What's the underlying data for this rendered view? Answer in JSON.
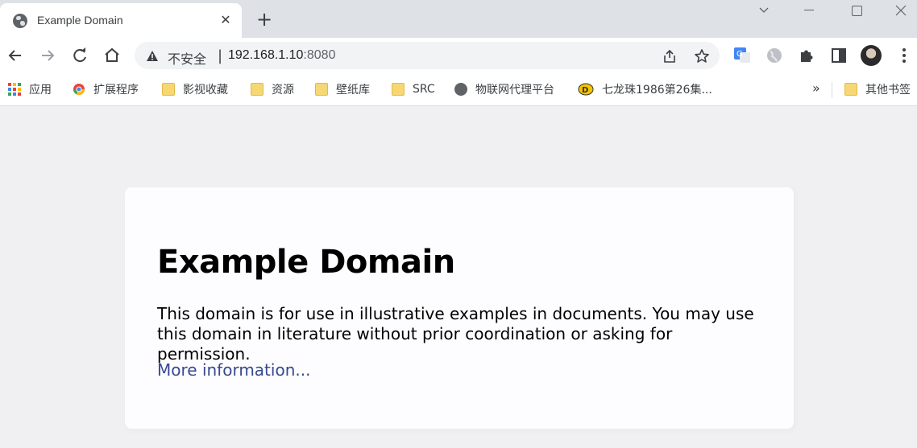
{
  "tab": {
    "title": "Example Domain",
    "close": "✕"
  },
  "new_tab": "+",
  "omnibox": {
    "security_label": "不安全",
    "separator": "|",
    "host": "192.168.1.10",
    "port": ":8080"
  },
  "bookmarks": {
    "items": [
      {
        "label": "应用",
        "icon": "apps-grid-icon"
      },
      {
        "label": "扩展程序",
        "icon": "chrome-icon"
      },
      {
        "label": "影视收藏",
        "icon": "folder-icon"
      },
      {
        "label": "资源",
        "icon": "folder-icon"
      },
      {
        "label": "壁纸库",
        "icon": "folder-icon"
      },
      {
        "label": "SRC",
        "icon": "folder-icon"
      },
      {
        "label": "物联网代理平台",
        "icon": "globe-icon"
      },
      {
        "label": "七龙珠1986第26集...",
        "icon": "dragon-ball-icon"
      }
    ],
    "more": "»",
    "other": {
      "label": "其他书签",
      "icon": "folder-icon"
    }
  },
  "page": {
    "heading": "Example Domain",
    "description": "This domain is for use in illustrative examples in documents. You may use this domain in literature without prior coordination or asking for permission.",
    "link": "More information..."
  },
  "colors": {
    "tabstrip": "#dee1e6",
    "page_background": "#f0f0f2",
    "card": "#fdfdff",
    "link": "#38488f"
  }
}
